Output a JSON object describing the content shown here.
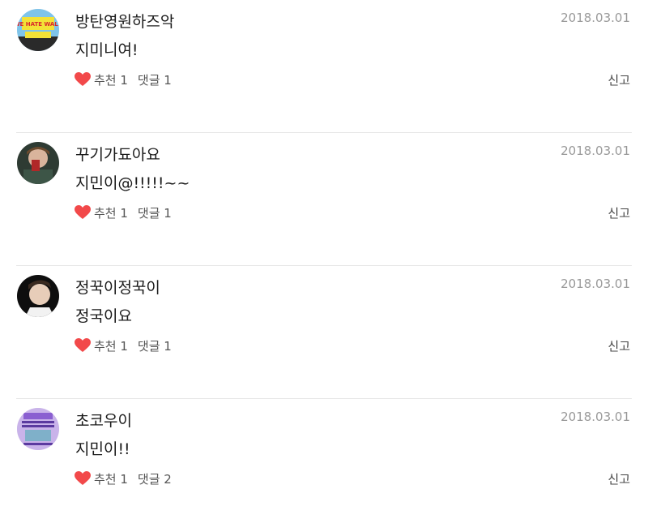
{
  "comments": [
    {
      "username": "방탄영원하즈악",
      "date": "2018.03.01",
      "text": "지미니여!",
      "likes_label": "추천 1",
      "replies_label": "댓글 1",
      "report_label": "신고",
      "avatar_icon": "avatar-image",
      "avatar_text": "WE HATE WALK"
    },
    {
      "username": "꾸기가됴아요",
      "date": "2018.03.01",
      "text": "지민이@!!!!!~~",
      "likes_label": "추천 1",
      "replies_label": "댓글 1",
      "report_label": "신고",
      "avatar_icon": "avatar-image"
    },
    {
      "username": "정꾹이정꾹이",
      "date": "2018.03.01",
      "text": "정국이요",
      "likes_label": "추천 1",
      "replies_label": "댓글 1",
      "report_label": "신고",
      "avatar_icon": "avatar-image"
    },
    {
      "username": "초코우이",
      "date": "2018.03.01",
      "text": "지민이!!",
      "likes_label": "추천 1",
      "replies_label": "댓글 2",
      "report_label": "신고",
      "avatar_icon": "avatar-image"
    }
  ],
  "colors": {
    "heart": "#f2494a",
    "divider": "#e6e6e6",
    "date": "#9a9a9a"
  },
  "icons": {
    "like": "heart-icon"
  }
}
